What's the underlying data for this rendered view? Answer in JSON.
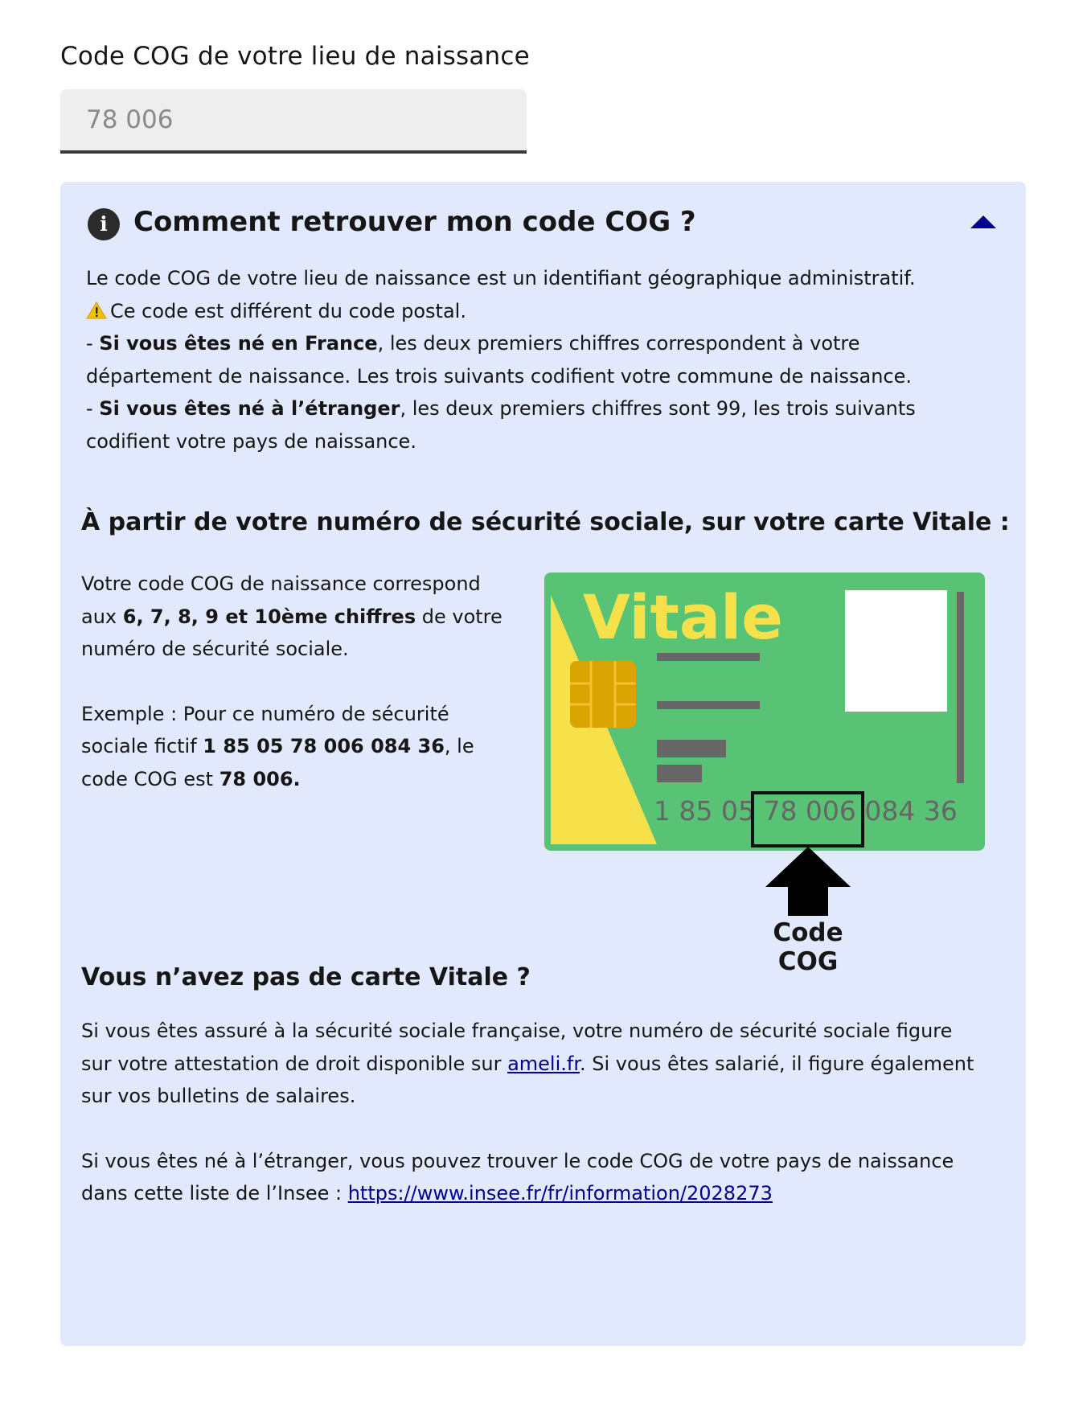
{
  "field": {
    "label": "Code COG de votre lieu de naissance",
    "placeholder": "78 006",
    "value": ""
  },
  "panel": {
    "title": "Comment retrouver mon code COG ?",
    "expanded": true,
    "icons": {
      "info": "info-icon",
      "toggle": "chevron-up-icon",
      "warning": "warning-icon"
    },
    "intro": {
      "line1": "Le code COG de votre lieu de naissance est un identifiant géographique administratif.",
      "warning": "Ce code est différent du code postal.",
      "france_prefix": "- ",
      "france_bold": "Si vous êtes né en France",
      "france_text": ", les deux premiers chiffres correspondent à votre département de naissance. Les trois suivants codifient votre commune de naissance.",
      "abroad_prefix": "- ",
      "abroad_bold": "Si vous êtes né à l’étranger",
      "abroad_text": ", les deux premiers chiffres sont 99, les trois suivants codifient votre pays de naissance."
    },
    "vitale_section": {
      "heading": "À partir de votre numéro de sécurité sociale, sur votre carte Vitale :",
      "p1_before": "Votre code COG de naissance correspond aux ",
      "p1_bold": "6, 7, 8, 9 et 10ème chiffres",
      "p1_after": " de votre numéro de sécurité sociale.",
      "p2_before": "Exemple : Pour ce numéro de sécurité sociale fictif ",
      "p2_bold_number": "1 85 05 78 006 084 36",
      "p2_mid": ",  le code COG est ",
      "p2_bold_code": "78 006."
    },
    "card": {
      "brand": "Vitale",
      "number_before": "1 85 05 ",
      "number_cog": "78 006",
      "number_after": " 084 36",
      "arrow_label": "Code COG",
      "colors": {
        "green": "#58c374",
        "yellow": "#f6e14a",
        "chip": "#d9a400",
        "bar": "#666666",
        "frame": "#111111"
      }
    },
    "no_vitale_section": {
      "heading": "Vous n’avez pas de carte Vitale ?",
      "p1_before": "Si vous êtes assuré à la sécurité sociale française, votre numéro de sécurité sociale figure sur votre attestation de droit disponible sur ",
      "p1_link": "ameli.fr",
      "p1_after": ". Si vous êtes salarié, il figure également sur vos bulletins de salaires.",
      "p2_before": "Si vous êtes né à l’étranger, vous pouvez trouver le code COG de votre pays de naissance dans cette liste de l’Insee : ",
      "p2_link": "https://www.insee.fr/fr/information/2028273"
    }
  },
  "colors": {
    "panel_bg": "#e3e9fc",
    "link": "#000091",
    "input_bg": "#eeeeee"
  }
}
